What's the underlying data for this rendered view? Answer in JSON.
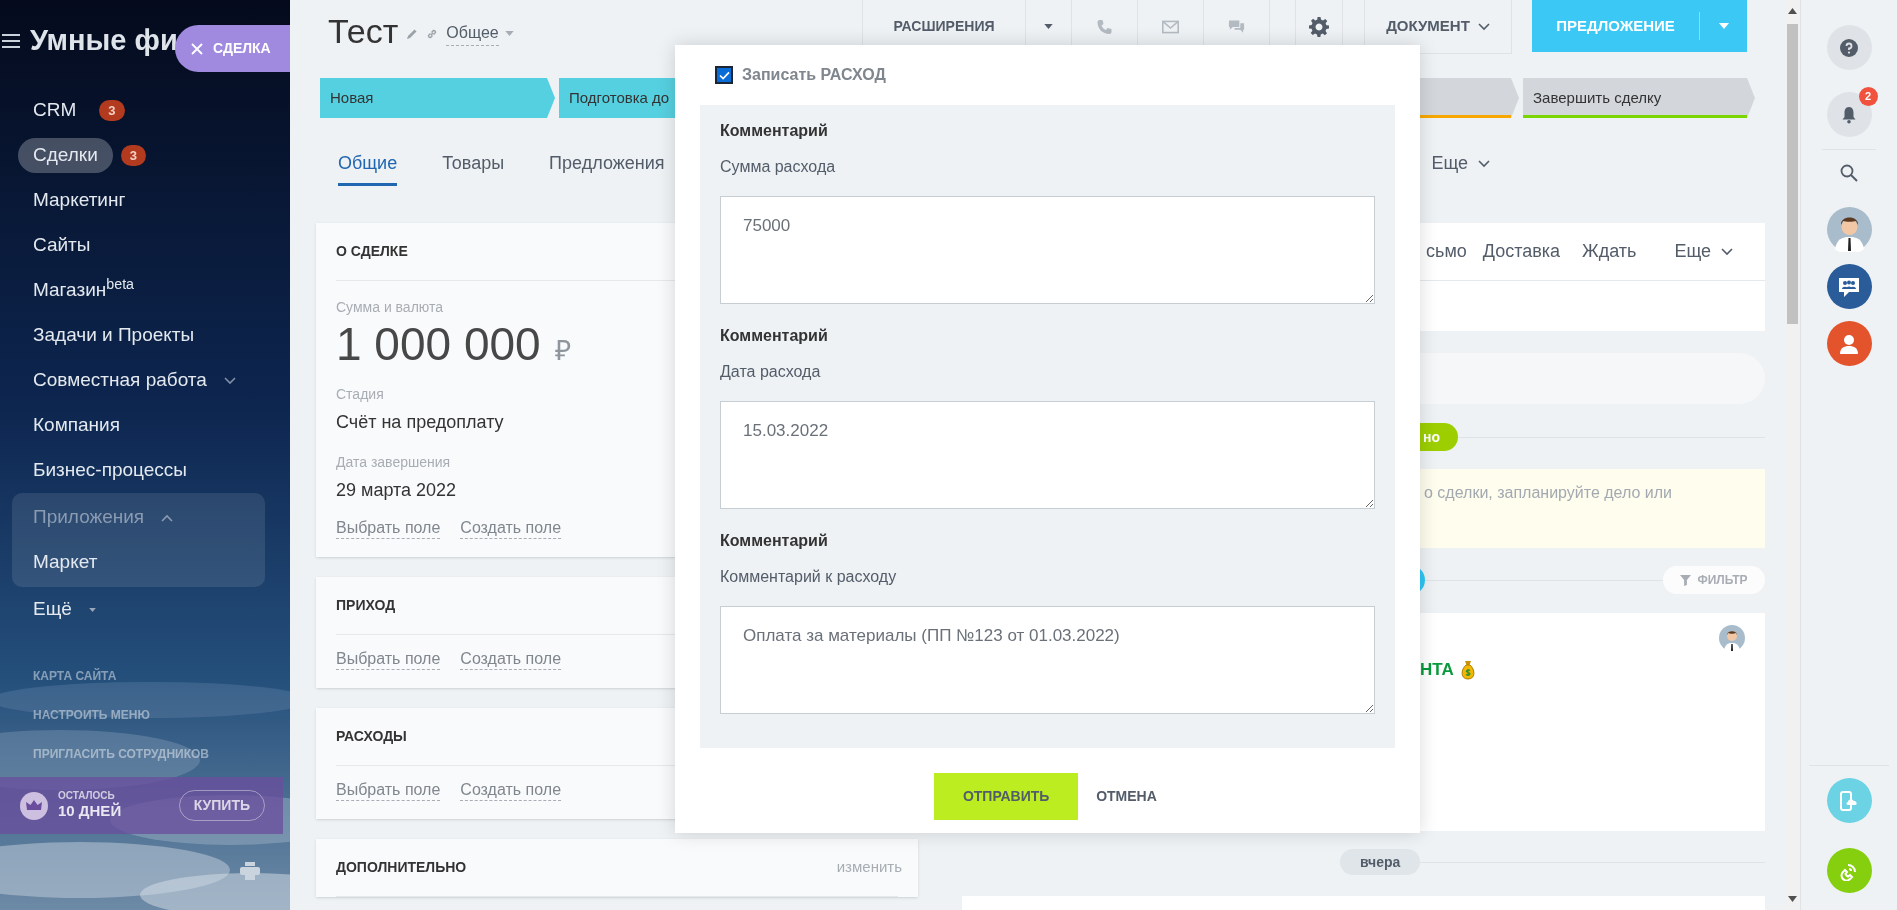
{
  "sidebar": {
    "title": "Умные фи",
    "deal_button": "СДЕЛКА",
    "items": [
      {
        "kind": "link",
        "label": "CRM",
        "counter": "3",
        "selected": false
      },
      {
        "kind": "link",
        "label": "Сделки",
        "counter": "3",
        "selected": true
      },
      {
        "kind": "link",
        "label": "Маркетинг",
        "selected": false
      },
      {
        "kind": "link",
        "label": "Сайты",
        "selected": false
      },
      {
        "kind": "link",
        "label": "Магазин$^{beta}$",
        "selected": false
      },
      {
        "kind": "link",
        "label": "Задачи и Проекты",
        "selected": false
      },
      {
        "kind": "toggle",
        "label": "Совместная работа",
        "expanded": false,
        "selected": false
      },
      {
        "kind": "link",
        "label": "Компания",
        "selected": false
      },
      {
        "kind": "link",
        "label": "Бизнес-процессы",
        "selected": false
      },
      {
        "kind": "group",
        "label": "Приложения",
        "expanded": true,
        "selected": false,
        "children": [
          {
            "kind": "link",
            "label": "Маркет",
            "selected": false
          }
        ]
      },
      {
        "kind": "more",
        "label": "Ещё",
        "selected": false
      }
    ],
    "footer_links": [
      "КАРТА САЙТА",
      "НАСТРОИТЬ МЕНЮ",
      "ПРИГЛАСИТЬ СОТРУДНИКОВ"
    ],
    "trial": {
      "caption": "ОСТАЛОСЬ",
      "days": "10 ДНЕЙ",
      "button": "КУПИТЬ"
    }
  },
  "header": {
    "title": "Тест",
    "category": "Общее",
    "extensions": "РАСШИРЕНИЯ",
    "document": "ДОКУМЕНТ",
    "primary": "ПРЕДЛОЖЕНИЕ"
  },
  "stages": [
    {
      "label": "Новая",
      "color": "#55d0e0",
      "passed": true
    },
    {
      "label": "Подготовка до",
      "color": "#55d0e0",
      "passed": true
    },
    {
      "color": "#f7a700",
      "passed": false
    },
    {
      "label": "Завершить сделку",
      "color": "#7bd500",
      "passed": false
    }
  ],
  "tabs": [
    {
      "label": "Общие",
      "selected": true
    },
    {
      "label": "Товары",
      "selected": false
    },
    {
      "label": "Предложения",
      "selected": false
    }
  ],
  "tabs_more": "Еще",
  "sections": [
    {
      "title": "О СДЕЛКЕ",
      "fields": [
        {
          "kind": "money",
          "label": "Сумма и валюта",
          "value": "1 000 000",
          "currency": "₽"
        },
        {
          "kind": "text",
          "label": "Стадия",
          "value": "Счёт на предоплату"
        },
        {
          "kind": "text",
          "label": "Дата завершения",
          "value": "29 марта 2022"
        }
      ],
      "actions": [
        "Выбрать поле",
        "Создать поле"
      ]
    },
    {
      "title": "ПРИХОД",
      "actions": [
        "Выбрать поле",
        "Создать поле"
      ]
    },
    {
      "title": "РАСХОДЫ",
      "actions": [
        "Выбрать поле",
        "Создать поле"
      ]
    },
    {
      "title": "ДОПОЛНИТЕЛЬНО",
      "edit": "изменить"
    }
  ],
  "timeline": {
    "activity_tabs": [
      "сьмо",
      "Доставка",
      "Ждать"
    ],
    "activity_more": "Еще",
    "planned_badge": "но",
    "hint": "о сделки, запланируйте дело или",
    "filter": "ФИЛЬТР",
    "entry_title": "НТА",
    "day": "вчера"
  },
  "modal": {
    "checkbox": {
      "label": "Записать РАСХОД",
      "checked": true
    },
    "fields": [
      {
        "heading": "Комментарий",
        "label": "Сумма расхода",
        "value": "75000"
      },
      {
        "heading": "Комментарий",
        "label": "Дата расхода",
        "value": "15.03.2022"
      },
      {
        "heading": "Комментарий",
        "label": "Комментарий к расходу",
        "value": "Оплата за материалы (ПП №123 от 01.03.2022)"
      }
    ],
    "submit": "ОТПРАВИТЬ",
    "cancel": "ОТМЕНА"
  },
  "right_panel": {
    "notifications": "2"
  }
}
